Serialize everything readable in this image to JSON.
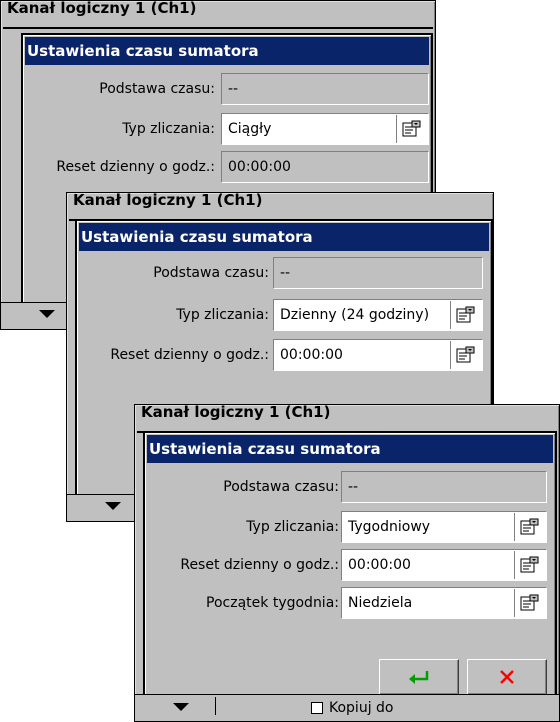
{
  "background_window_title": "Kanał logiczny 1 (Ch1)",
  "bottom_bar": {
    "copy_label": "Kopiuj do"
  },
  "dialogs": [
    {
      "title": "Ustawienia czasu sumatora",
      "fields": {
        "time_base": {
          "label": "Podstawa czasu:",
          "value": "--"
        },
        "count_type": {
          "label": "Typ zliczania:",
          "value": "Ciągły"
        },
        "daily_reset": {
          "label": "Reset dzienny o godz.:",
          "value": "00:00:00"
        }
      }
    },
    {
      "title": "Ustawienia czasu sumatora",
      "fields": {
        "time_base": {
          "label": "Podstawa czasu:",
          "value": "--"
        },
        "count_type": {
          "label": "Typ zliczania:",
          "value": "Dzienny (24 godziny)"
        },
        "daily_reset": {
          "label": "Reset dzienny o godz.:",
          "value": "00:00:00"
        }
      }
    },
    {
      "title": "Ustawienia czasu sumatora",
      "fields": {
        "time_base": {
          "label": "Podstawa czasu:",
          "value": "--"
        },
        "count_type": {
          "label": "Typ zliczania:",
          "value": "Tygodniowy"
        },
        "daily_reset": {
          "label": "Reset dzienny o godz.:",
          "value": "00:00:00"
        },
        "week_start": {
          "label": "Początek tygodnia:",
          "value": "Niedziela"
        }
      },
      "buttons": {
        "ok_icon": "enter-arrow-icon",
        "cancel_icon": "x-icon"
      }
    }
  ],
  "colors": {
    "title_bar": "#0a246a",
    "ok_icon": "#00a000",
    "cancel_icon": "#ff0000",
    "panel": "#c0c0c0"
  }
}
